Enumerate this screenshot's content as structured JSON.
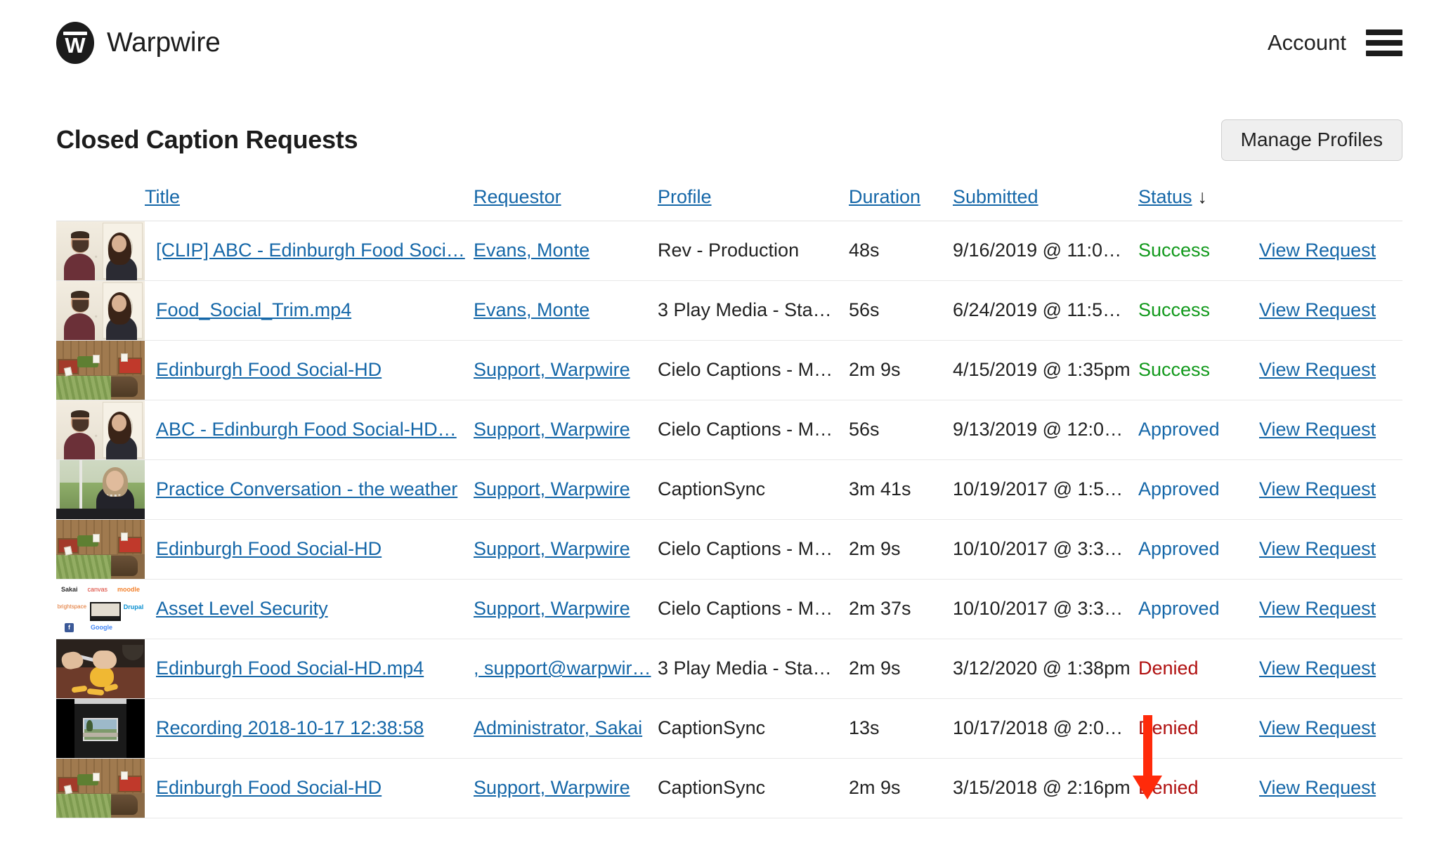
{
  "header": {
    "brand_name": "Warpwire",
    "logo_letter": "W",
    "account_label": "Account",
    "menu_icon": "hamburger-icon"
  },
  "page": {
    "title": "Closed Caption Requests",
    "manage_profiles_label": "Manage Profiles"
  },
  "table": {
    "columns": [
      {
        "key": "thumbnail",
        "label": "",
        "sortable": false
      },
      {
        "key": "title",
        "label": "Title",
        "sortable": true
      },
      {
        "key": "requestor",
        "label": "Requestor",
        "sortable": true
      },
      {
        "key": "profile",
        "label": "Profile",
        "sortable": true
      },
      {
        "key": "duration",
        "label": "Duration",
        "sortable": true
      },
      {
        "key": "submitted",
        "label": "Submitted",
        "sortable": true
      },
      {
        "key": "status",
        "label": "Status",
        "sortable": true
      },
      {
        "key": "view",
        "label": "",
        "sortable": false
      }
    ],
    "sort": {
      "column": "Status",
      "direction": "descending",
      "indicator": "↓"
    },
    "view_request_label": "View Request",
    "rows": [
      {
        "thumbnail": "interview",
        "title": "[CLIP] ABC - Edinburgh Food Soci…",
        "requestor": "Evans, Monte",
        "profile": "Rev - Production",
        "duration": "48s",
        "submitted": "9/16/2019 @ 11:0…",
        "status": "Success"
      },
      {
        "thumbnail": "interview",
        "title": "Food_Social_Trim.mp4",
        "requestor": "Evans, Monte",
        "profile": "3 Play Media - Sta…",
        "duration": "56s",
        "submitted": "6/24/2019 @ 11:5…",
        "status": "Success"
      },
      {
        "thumbnail": "market",
        "title": "Edinburgh Food Social-HD",
        "requestor": "Support, Warpwire",
        "profile": "Cielo Captions - M…",
        "duration": "2m 9s",
        "submitted": "4/15/2019 @ 1:35pm",
        "status": "Success"
      },
      {
        "thumbnail": "interview",
        "title": "ABC - Edinburgh Food Social-HD…",
        "requestor": "Support, Warpwire",
        "profile": "Cielo Captions - M…",
        "duration": "56s",
        "submitted": "9/13/2019 @ 12:0…",
        "status": "Approved"
      },
      {
        "thumbnail": "outdoor",
        "title": "Practice Conversation - the weather",
        "requestor": "Support, Warpwire",
        "profile": "CaptionSync",
        "duration": "3m 41s",
        "submitted": "10/19/2017 @ 1:5…",
        "status": "Approved"
      },
      {
        "thumbnail": "market",
        "title": "Edinburgh Food Social-HD",
        "requestor": "Support, Warpwire",
        "profile": "Cielo Captions - M…",
        "duration": "2m 9s",
        "submitted": "10/10/2017 @ 3:3…",
        "status": "Approved"
      },
      {
        "thumbnail": "lms",
        "title": "Asset Level Security",
        "requestor": "Support, Warpwire",
        "profile": "Cielo Captions - M…",
        "duration": "2m 37s",
        "submitted": "10/10/2017 @ 3:3…",
        "status": "Approved"
      },
      {
        "thumbnail": "mango",
        "title": "Edinburgh Food Social-HD.mp4",
        "requestor": ", support@warpwir…",
        "profile": "3 Play Media - Sta…",
        "duration": "2m 9s",
        "submitted": "3/12/2020 @ 1:38pm",
        "status": "Denied"
      },
      {
        "thumbnail": "screen",
        "title": "Recording 2018-10-17 12:38:58",
        "requestor": "Administrator, Sakai",
        "profile": "CaptionSync",
        "duration": "13s",
        "submitted": "10/17/2018 @ 2:0…",
        "status": "Denied"
      },
      {
        "thumbnail": "market",
        "title": "Edinburgh Food Social-HD",
        "requestor": "Support, Warpwire",
        "profile": "CaptionSync",
        "duration": "2m 9s",
        "submitted": "3/15/2018 @ 2:16pm",
        "status": "Denied"
      }
    ]
  },
  "annotation": {
    "type": "arrow",
    "direction": "down",
    "color": "#ff2a0a",
    "points_to": "Denied"
  },
  "colors": {
    "link": "#1567a8",
    "success": "#12991c",
    "approved": "#1567a8",
    "denied": "#b01010",
    "annotation": "#ff2a0a"
  },
  "lms_logos": {
    "sakai": "Sakai",
    "canvas": "canvas",
    "moodle": "moodle",
    "brightspace": "brightspace",
    "drupal": "Drupal",
    "facebook": "f",
    "google": "Google"
  }
}
